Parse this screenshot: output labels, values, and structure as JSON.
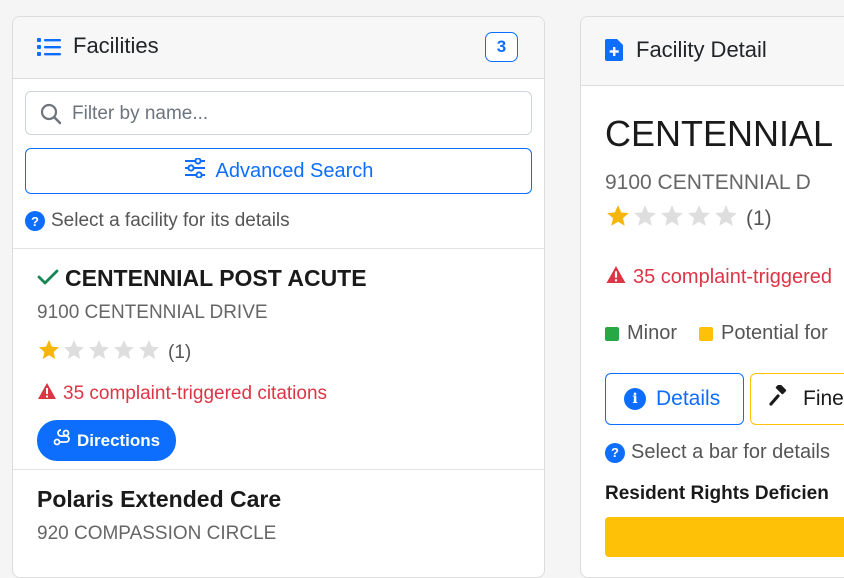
{
  "left_panel": {
    "title": "Facilities",
    "count": "3",
    "search": {
      "placeholder": "Filter by name...",
      "value": ""
    },
    "advanced_search_label": "Advanced Search",
    "hint": "Select a facility for its details",
    "facilities": [
      {
        "name": "CENTENNIAL POST ACUTE",
        "selected": true,
        "address": "9100 CENTENNIAL DRIVE",
        "rating": 1,
        "max_rating": 5,
        "rating_count": "(1)",
        "citations": "35 complaint-triggered citations",
        "directions_label": "Directions"
      },
      {
        "name": "Polaris Extended Care",
        "address": "920 COMPASSION CIRCLE"
      }
    ]
  },
  "right_panel": {
    "title": "Facility Detail",
    "facility_name": "CENTENNIAL",
    "address": "9100 CENTENNIAL D",
    "rating": 1,
    "max_rating": 5,
    "rating_count": "(1)",
    "citations": "35 complaint-triggered",
    "legend": [
      {
        "label": "Minor",
        "color": "#28a745"
      },
      {
        "label": "Potential for",
        "color": "#ffc107"
      }
    ],
    "details_label": "Details",
    "fines_label": "Fine",
    "hint": "Select a bar for details",
    "section_title": "Resident Rights Deficien"
  },
  "colors": {
    "primary": "#0d6efd",
    "danger": "#dc3545",
    "star_filled": "#f5b50a",
    "star_empty": "#dedede",
    "warning": "#ffc107",
    "success": "#28a745"
  }
}
